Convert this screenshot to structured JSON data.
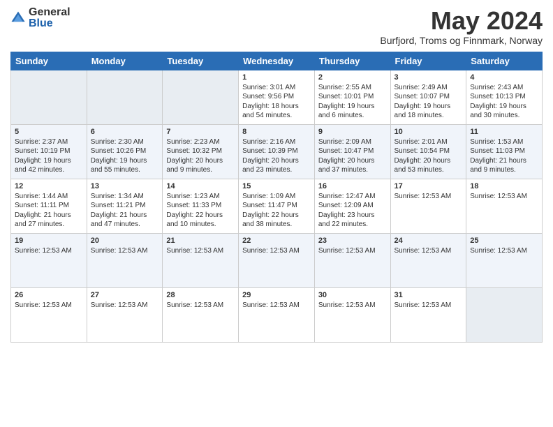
{
  "header": {
    "logo_general": "General",
    "logo_blue": "Blue",
    "month_title": "May 2024",
    "subtitle": "Burfjord, Troms og Finnmark, Norway"
  },
  "days_of_week": [
    "Sunday",
    "Monday",
    "Tuesday",
    "Wednesday",
    "Thursday",
    "Friday",
    "Saturday"
  ],
  "weeks": [
    [
      {
        "day": "",
        "info": ""
      },
      {
        "day": "",
        "info": ""
      },
      {
        "day": "",
        "info": ""
      },
      {
        "day": "1",
        "info": "Sunrise: 3:01 AM\nSunset: 9:56 PM\nDaylight: 18 hours and 54 minutes."
      },
      {
        "day": "2",
        "info": "Sunrise: 2:55 AM\nSunset: 10:01 PM\nDaylight: 19 hours and 6 minutes."
      },
      {
        "day": "3",
        "info": "Sunrise: 2:49 AM\nSunset: 10:07 PM\nDaylight: 19 hours and 18 minutes."
      },
      {
        "day": "4",
        "info": "Sunrise: 2:43 AM\nSunset: 10:13 PM\nDaylight: 19 hours and 30 minutes."
      }
    ],
    [
      {
        "day": "5",
        "info": "Sunrise: 2:37 AM\nSunset: 10:19 PM\nDaylight: 19 hours and 42 minutes."
      },
      {
        "day": "6",
        "info": "Sunrise: 2:30 AM\nSunset: 10:26 PM\nDaylight: 19 hours and 55 minutes."
      },
      {
        "day": "7",
        "info": "Sunrise: 2:23 AM\nSunset: 10:32 PM\nDaylight: 20 hours and 9 minutes."
      },
      {
        "day": "8",
        "info": "Sunrise: 2:16 AM\nSunset: 10:39 PM\nDaylight: 20 hours and 23 minutes."
      },
      {
        "day": "9",
        "info": "Sunrise: 2:09 AM\nSunset: 10:47 PM\nDaylight: 20 hours and 37 minutes."
      },
      {
        "day": "10",
        "info": "Sunrise: 2:01 AM\nSunset: 10:54 PM\nDaylight: 20 hours and 53 minutes."
      },
      {
        "day": "11",
        "info": "Sunrise: 1:53 AM\nSunset: 11:03 PM\nDaylight: 21 hours and 9 minutes."
      }
    ],
    [
      {
        "day": "12",
        "info": "Sunrise: 1:44 AM\nSunset: 11:11 PM\nDaylight: 21 hours and 27 minutes."
      },
      {
        "day": "13",
        "info": "Sunrise: 1:34 AM\nSunset: 11:21 PM\nDaylight: 21 hours and 47 minutes."
      },
      {
        "day": "14",
        "info": "Sunrise: 1:23 AM\nSunset: 11:33 PM\nDaylight: 22 hours and 10 minutes."
      },
      {
        "day": "15",
        "info": "Sunrise: 1:09 AM\nSunset: 11:47 PM\nDaylight: 22 hours and 38 minutes."
      },
      {
        "day": "16",
        "info": "Sunrise: 12:47 AM\nSunset: 12:09 AM\nDaylight: 23 hours and 22 minutes."
      },
      {
        "day": "17",
        "info": "Sunrise: 12:53 AM"
      },
      {
        "day": "18",
        "info": "Sunrise: 12:53 AM"
      }
    ],
    [
      {
        "day": "19",
        "info": "Sunrise: 12:53 AM"
      },
      {
        "day": "20",
        "info": "Sunrise: 12:53 AM"
      },
      {
        "day": "21",
        "info": "Sunrise: 12:53 AM"
      },
      {
        "day": "22",
        "info": "Sunrise: 12:53 AM"
      },
      {
        "day": "23",
        "info": "Sunrise: 12:53 AM"
      },
      {
        "day": "24",
        "info": "Sunrise: 12:53 AM"
      },
      {
        "day": "25",
        "info": "Sunrise: 12:53 AM"
      }
    ],
    [
      {
        "day": "26",
        "info": "Sunrise: 12:53 AM"
      },
      {
        "day": "27",
        "info": "Sunrise: 12:53 AM"
      },
      {
        "day": "28",
        "info": "Sunrise: 12:53 AM"
      },
      {
        "day": "29",
        "info": "Sunrise: 12:53 AM"
      },
      {
        "day": "30",
        "info": "Sunrise: 12:53 AM"
      },
      {
        "day": "31",
        "info": "Sunrise: 12:53 AM"
      },
      {
        "day": "",
        "info": ""
      }
    ]
  ]
}
